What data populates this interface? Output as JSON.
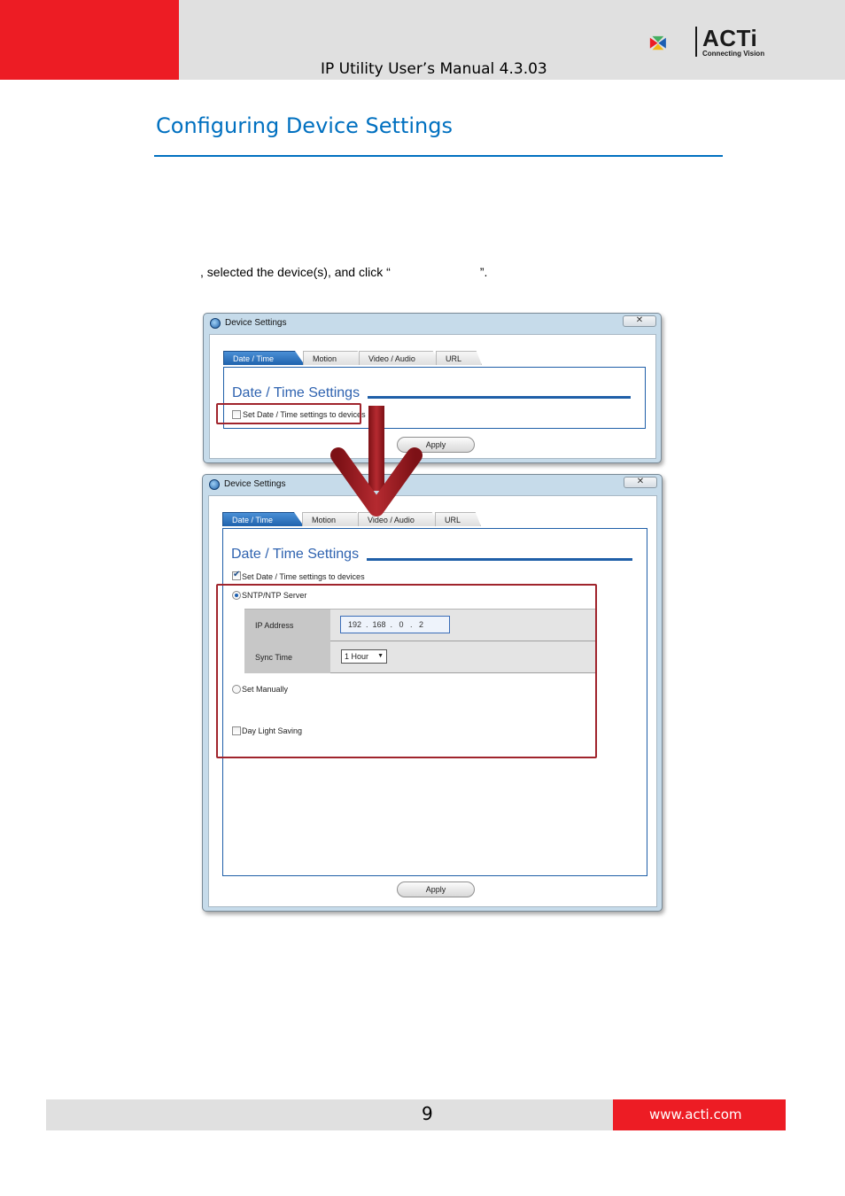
{
  "header": {
    "title": "IP Utility User’s Manual 4.3.03",
    "logo_text": "ACTi",
    "logo_tagline": "Connecting Vision",
    "colors": {
      "red": "#ed1c24",
      "grey": "#e0e0e0"
    }
  },
  "section": {
    "title": "Configuring Device Settings",
    "color": "#0070c0",
    "body_line": ", selected the device(s), and click “                          ”."
  },
  "dialog_before": {
    "title": "Device Settings",
    "close_glyph": "✕",
    "tabs": [
      "Date / Time",
      "Motion",
      "Video / Audio",
      "URL"
    ],
    "active_tab": "Date / Time",
    "panel_title": "Date / Time Settings",
    "checkbox_label": "Set Date / Time settings to devices",
    "checkbox_checked": false,
    "apply_label": "Apply"
  },
  "dialog_after": {
    "title": "Device Settings",
    "close_glyph": "✕",
    "tabs": [
      "Date / Time",
      "Motion",
      "Video / Audio",
      "URL"
    ],
    "active_tab": "Date / Time",
    "panel_title": "Date / Time Settings",
    "checkbox_label": "Set Date / Time settings to devices",
    "checkbox_checked": true,
    "sntp_label": "SNTP/NTP Server",
    "sntp_selected": true,
    "ip_address_label": "IP Address",
    "ip_address_value": "192  .  168  .   0   .   2",
    "sync_time_label": "Sync Time",
    "sync_time_value": "1 Hour",
    "set_manually_label": "Set Manually",
    "daylight_label": "Day Light Saving",
    "apply_label": "Apply"
  },
  "icons": [
    "acti-logo-icon",
    "device-settings-app-icon",
    "close-icon",
    "down-arrow-icon",
    "dropdown-arrow-icon"
  ],
  "highlight_color": "#a0242c",
  "footer": {
    "page_number": "9",
    "url": "www.acti.com"
  }
}
